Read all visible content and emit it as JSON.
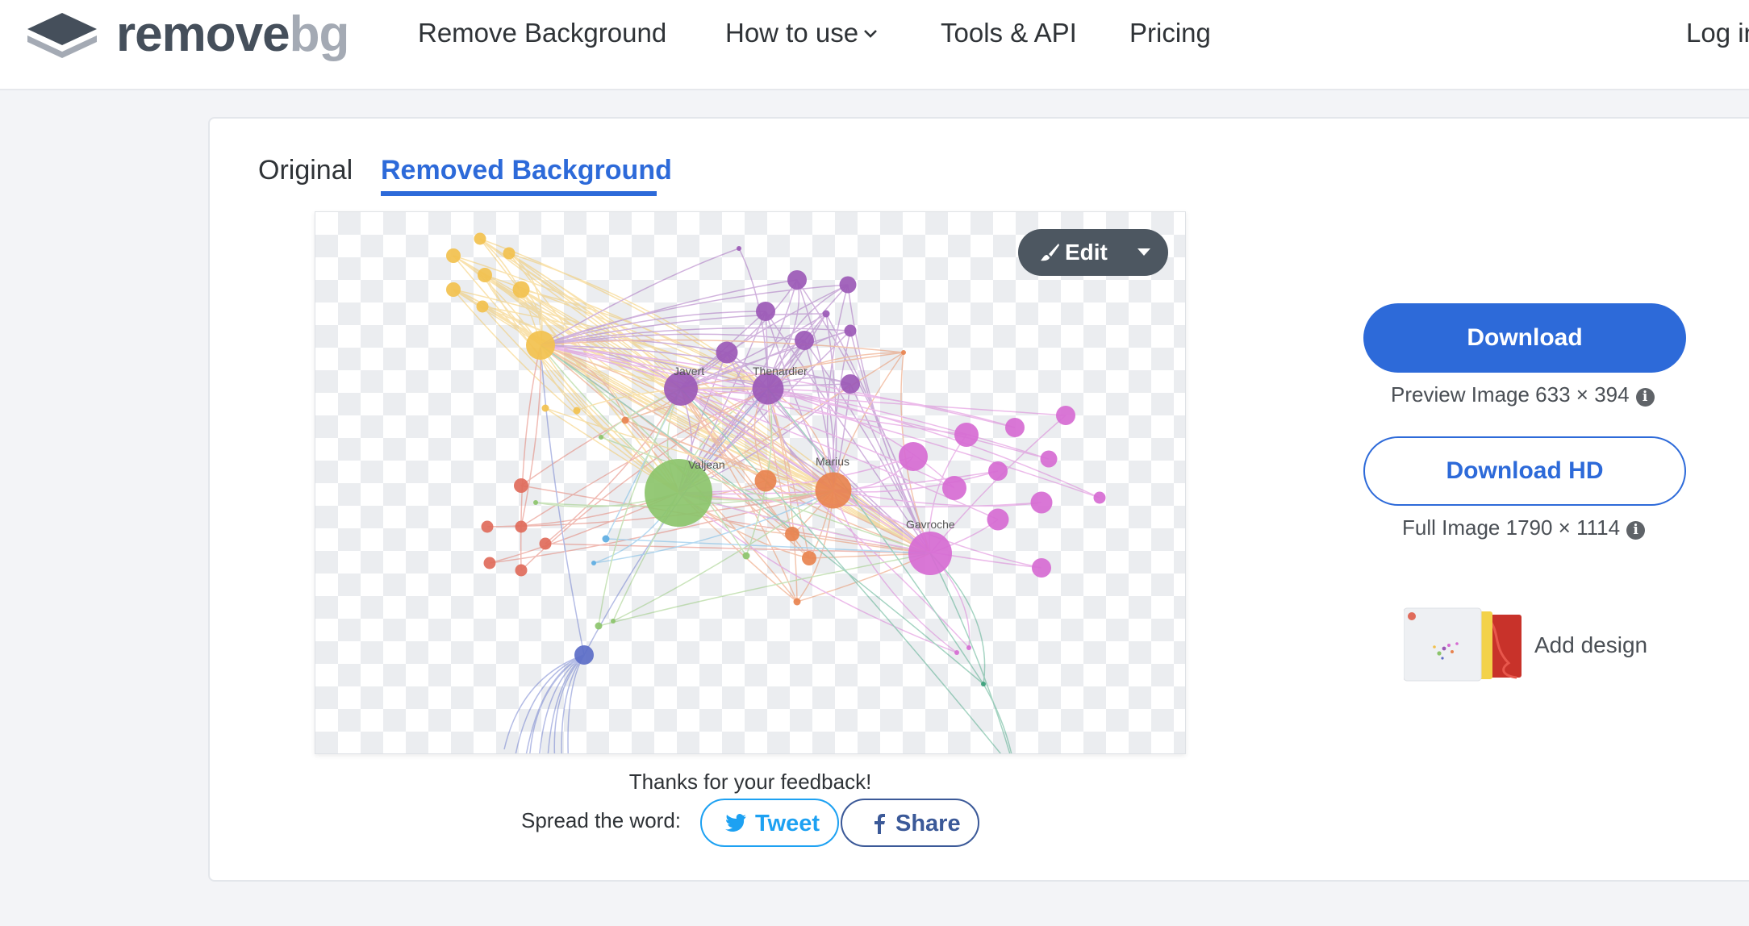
{
  "header": {
    "logo": {
      "word1": "remove",
      "word2": "bg"
    },
    "nav": [
      {
        "label": "Remove Background"
      },
      {
        "label": "How to use",
        "has_dropdown": true
      },
      {
        "label": "Tools & API"
      },
      {
        "label": "Pricing"
      },
      {
        "label": "Log in"
      }
    ]
  },
  "tabs": [
    {
      "label": "Original",
      "active": false
    },
    {
      "label": "Removed Background",
      "active": true
    }
  ],
  "preview": {
    "edit": {
      "label": "Edit",
      "icon": "brush-icon"
    },
    "graph_labels": [
      "Javert",
      "Thenardier",
      "Valjean",
      "Marius",
      "Gavroche"
    ]
  },
  "actions": {
    "download": {
      "label": "Download"
    },
    "preview_info": "Preview Image 633 × 394",
    "download_hd": {
      "label": "Download HD"
    },
    "full_info": "Full Image 1790 × 1114",
    "add_design": {
      "label": "Add design"
    }
  },
  "feedback": {
    "thanks": "Thanks for your feedback!",
    "spread_label": "Spread the word:",
    "tweet": "Tweet",
    "share": "Share"
  },
  "colors": {
    "brand_blue": "#2d6ad9",
    "twitter_blue": "#1da1f2",
    "facebook_blue": "#3b5998",
    "edit_button": "#4d5761"
  }
}
